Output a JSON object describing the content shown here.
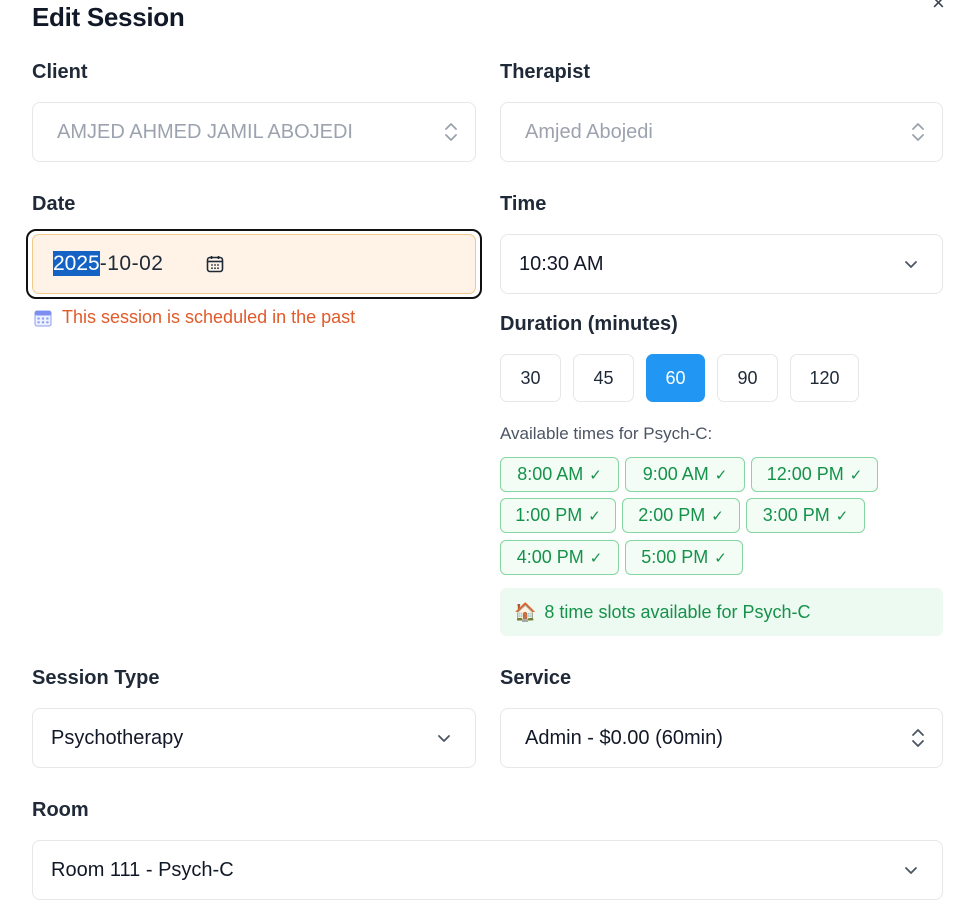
{
  "dialog": {
    "title": "Edit Session",
    "close_glyph": "×"
  },
  "client": {
    "label": "Client",
    "value": "AMJED AHMED JAMIL ABOJEDI"
  },
  "therapist": {
    "label": "Therapist",
    "value": "Amjed Abojedi"
  },
  "date": {
    "label": "Date",
    "year": "2025",
    "rest": "-10-02",
    "warning": "This session is scheduled in the past",
    "warning_icon": "calendar-icon"
  },
  "time": {
    "label": "Time",
    "value": "10:30 AM"
  },
  "duration": {
    "label": "Duration (minutes)",
    "options": [
      "30",
      "45",
      "60",
      "90",
      "120"
    ],
    "selected": "60"
  },
  "availability": {
    "heading": "Available times for Psych-C:",
    "slots": [
      "8:00 AM",
      "9:00 AM",
      "12:00 PM",
      "1:00 PM",
      "2:00 PM",
      "3:00 PM",
      "4:00 PM",
      "5:00 PM"
    ],
    "check_glyph": "✓",
    "summary_icon": "🏠",
    "summary": "8 time slots available for Psych-C"
  },
  "session_type": {
    "label": "Session Type",
    "value": "Psychotherapy"
  },
  "service": {
    "label": "Service",
    "value": "Admin - $0.00 (60min)"
  },
  "room": {
    "label": "Room",
    "value": "Room 111 - Psych-C"
  },
  "colors": {
    "accent": "#2196f3",
    "warning": "#e15a2a",
    "success": "#15924a"
  }
}
